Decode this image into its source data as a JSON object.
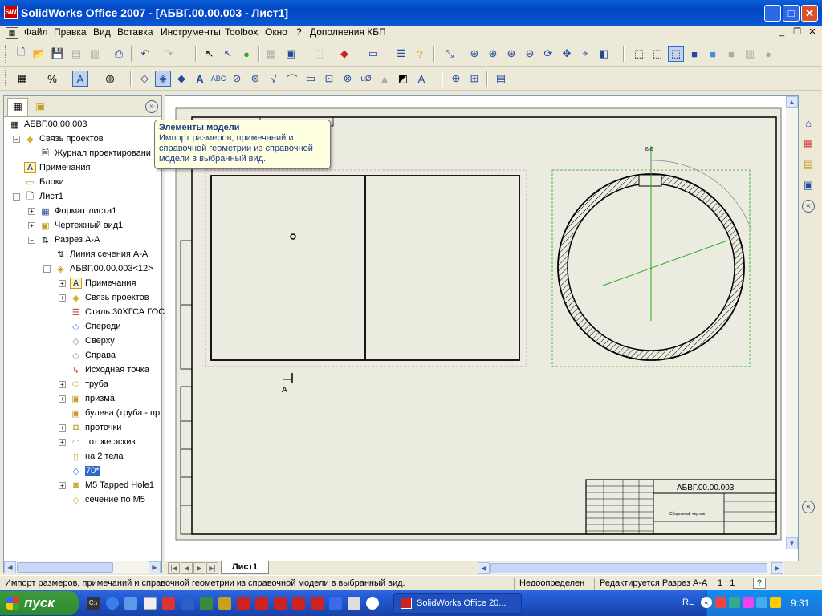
{
  "window": {
    "title": "SolidWorks Office 2007 - [АБВГ.00.00.003 - Лист1]",
    "logo_text": "SW"
  },
  "menu": {
    "items": [
      "Файл",
      "Правка",
      "Вид",
      "Вставка",
      "Инструменты",
      "Toolbox",
      "Окно",
      "?",
      "Дополнения КБП"
    ]
  },
  "tree": {
    "root": "АБВГ.00.00.003",
    "items": [
      "Связь проектов",
      "Журнал проектировани",
      "Примечания",
      "Блоки",
      "Лист1",
      "Формат листа1",
      "Чертежный вид1",
      "Разрез А-А",
      "Линия сечения А-А",
      "АБВГ.00.00.003<12>",
      "Примечания",
      "Связь проектов",
      "Сталь 30ХГСА ГОС",
      "Спереди",
      "Сверху",
      "Справа",
      "Исходная точка",
      "труба",
      "призма",
      "булева (труба - пр",
      "проточки",
      "тот же эскиз",
      "на 2 тела",
      "70*",
      "M5 Tapped Hole1",
      "сечение по М5"
    ]
  },
  "tooltip": {
    "title": "Элементы модели",
    "body": "Импорт размеров, примечаний и справочной геометрии из справочной модели в выбранный вид."
  },
  "drawing": {
    "section_label": "Б-Б",
    "arrow_label": "А",
    "title_block_code": "АБВГ.00.00.003",
    "title_block_name": "Сборочный чертеж"
  },
  "sheet_tab": "Лист1",
  "status": {
    "message": "Импорт размеров, примечаний и справочной геометрии из справочной модели в выбранный вид.",
    "state": "Недоопределен",
    "editing": "Редактируется Разрез А-А",
    "scale": "1 : 1",
    "help": "?"
  },
  "taskbar": {
    "start": "пуск",
    "window_item": "SolidWorks Office 20...",
    "lang": "RL",
    "clock": "9:31"
  }
}
